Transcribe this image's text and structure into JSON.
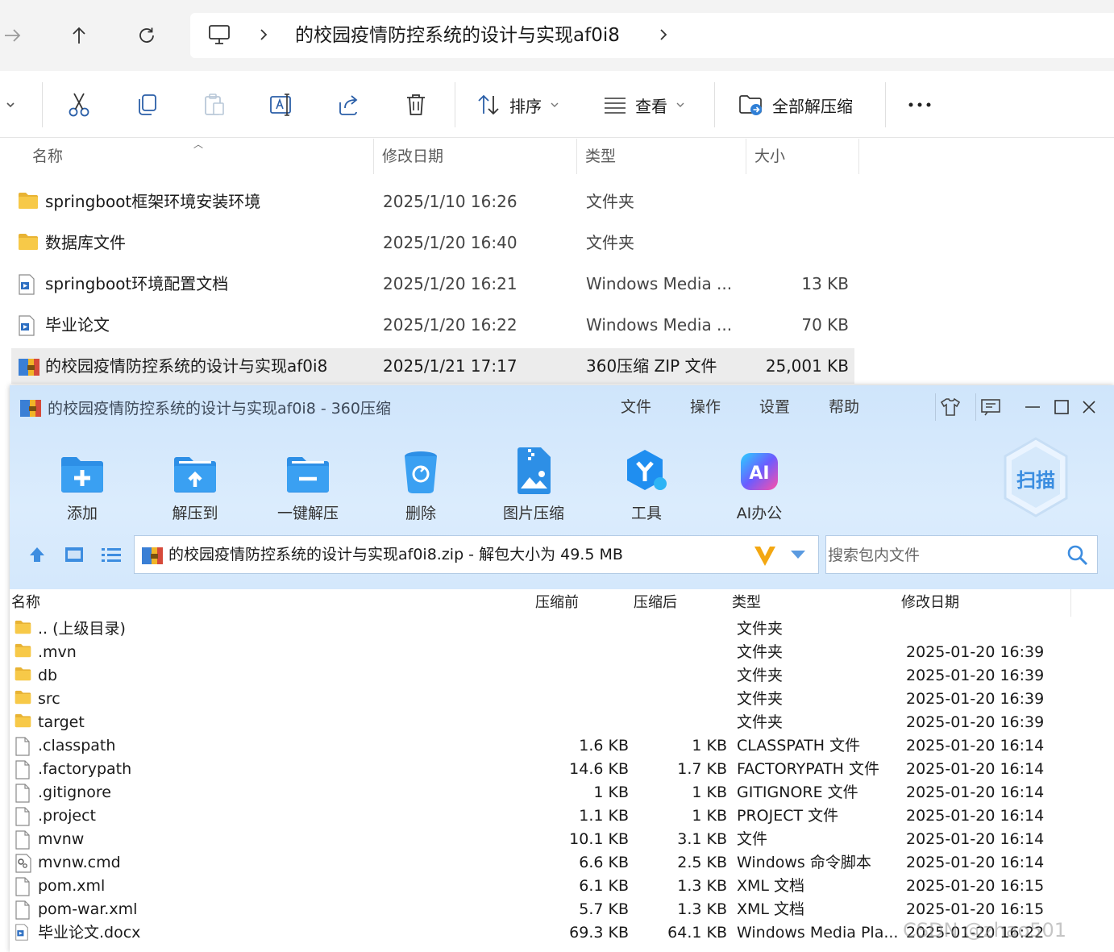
{
  "explorer": {
    "breadcrumb": {
      "path": "的校园疫情防控系统的设计与实现af0i8"
    },
    "commands": {
      "sort_label": "排序",
      "view_label": "查看",
      "extract_label": "全部解压缩"
    },
    "columns": {
      "name": "名称",
      "modified": "修改日期",
      "type": "类型",
      "size": "大小"
    },
    "files": [
      {
        "name": "springboot框架环境安装环境",
        "modified": "2025/1/10 16:26",
        "type": "文件夹",
        "size": "",
        "icon": "folder-icon"
      },
      {
        "name": "数据库文件",
        "modified": "2025/1/20 16:40",
        "type": "文件夹",
        "size": "",
        "icon": "folder-icon"
      },
      {
        "name": "springboot环境配置文档",
        "modified": "2025/1/20 16:21",
        "type": "Windows Media ...",
        "size": "13 KB",
        "icon": "media-doc-icon"
      },
      {
        "name": "毕业论文",
        "modified": "2025/1/20 16:22",
        "type": "Windows Media ...",
        "size": "70 KB",
        "icon": "media-doc-icon"
      },
      {
        "name": "的校园疫情防控系统的设计与实现af0i8",
        "modified": "2025/1/21 17:17",
        "type": "360压缩 ZIP 文件",
        "size": "25,001 KB",
        "icon": "zip-archive-icon",
        "selected": true
      }
    ]
  },
  "zip": {
    "title": "的校园疫情防控系统的设计与实现af0i8 - 360压缩",
    "menu": [
      "文件",
      "操作",
      "设置",
      "帮助"
    ],
    "tools": [
      "添加",
      "解压到",
      "一键解压",
      "删除",
      "图片压缩",
      "工具",
      "AI办公"
    ],
    "scan_label": "扫描",
    "path_text": "的校园疫情防控系统的设计与实现af0i8.zip - 解包大小为 49.5 MB",
    "search_placeholder": "搜索包内文件",
    "columns": {
      "name": "名称",
      "before": "压缩前",
      "after": "压缩后",
      "type": "类型",
      "modified": "修改日期"
    },
    "entries": [
      {
        "name": ".. (上级目录)",
        "before": "",
        "after": "",
        "type": "文件夹",
        "modified": "",
        "icon": "folder-icon"
      },
      {
        "name": ".mvn",
        "before": "",
        "after": "",
        "type": "文件夹",
        "modified": "2025-01-20 16:39",
        "icon": "folder-icon"
      },
      {
        "name": "db",
        "before": "",
        "after": "",
        "type": "文件夹",
        "modified": "2025-01-20 16:39",
        "icon": "folder-icon"
      },
      {
        "name": "src",
        "before": "",
        "after": "",
        "type": "文件夹",
        "modified": "2025-01-20 16:39",
        "icon": "folder-icon"
      },
      {
        "name": "target",
        "before": "",
        "after": "",
        "type": "文件夹",
        "modified": "2025-01-20 16:39",
        "icon": "folder-icon"
      },
      {
        "name": ".classpath",
        "before": "1.6 KB",
        "after": "1 KB",
        "type": "CLASSPATH 文件",
        "modified": "2025-01-20 16:14",
        "icon": "file-icon"
      },
      {
        "name": ".factorypath",
        "before": "14.6 KB",
        "after": "1.7 KB",
        "type": "FACTORYPATH 文件",
        "modified": "2025-01-20 16:14",
        "icon": "file-icon"
      },
      {
        "name": ".gitignore",
        "before": "1 KB",
        "after": "1 KB",
        "type": "GITIGNORE 文件",
        "modified": "2025-01-20 16:14",
        "icon": "file-icon"
      },
      {
        "name": ".project",
        "before": "1.1 KB",
        "after": "1 KB",
        "type": "PROJECT 文件",
        "modified": "2025-01-20 16:14",
        "icon": "file-icon"
      },
      {
        "name": "mvnw",
        "before": "10.1 KB",
        "after": "3.1 KB",
        "type": "文件",
        "modified": "2025-01-20 16:14",
        "icon": "file-icon"
      },
      {
        "name": "mvnw.cmd",
        "before": "6.6 KB",
        "after": "2.5 KB",
        "type": "Windows 命令脚本",
        "modified": "2025-01-20 16:14",
        "icon": "cmd-script-icon"
      },
      {
        "name": "pom.xml",
        "before": "6.1 KB",
        "after": "1.3 KB",
        "type": "XML 文档",
        "modified": "2025-01-20 16:15",
        "icon": "file-icon"
      },
      {
        "name": "pom-war.xml",
        "before": "5.7 KB",
        "after": "1.3 KB",
        "type": "XML 文档",
        "modified": "2025-01-20 16:15",
        "icon": "file-icon"
      },
      {
        "name": "毕业论文.docx",
        "before": "69.3 KB",
        "after": "64.1 KB",
        "type": "Windows Media Pla...",
        "modified": "2025-01-20 16:22",
        "icon": "media-doc-icon"
      }
    ]
  },
  "watermark": "CSDN @zhao501",
  "colors": {
    "zip_accent": "#2f8ee8",
    "folder": "#f7c948",
    "selection": "#ececec"
  }
}
